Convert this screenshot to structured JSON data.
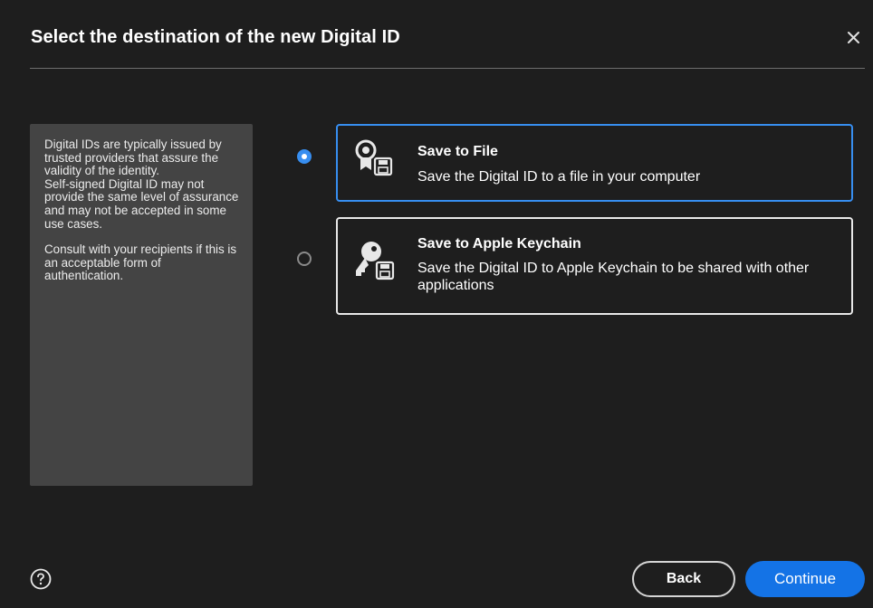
{
  "dialog": {
    "title": "Select the destination of the new Digital ID",
    "close_icon": "close-icon"
  },
  "info": {
    "paragraph1": "Digital IDs are typically issued by trusted providers that assure the validity of the identity.",
    "paragraph2": "Self-signed Digital ID may not provide the same level of assurance and may not be accepted in some use cases.",
    "paragraph3": "Consult with your recipients if this is an acceptable form of authentication."
  },
  "options": [
    {
      "title": "Save to File",
      "description": "Save the Digital ID to a file in your computer",
      "icon": "certificate-file-icon",
      "selected": true
    },
    {
      "title": "Save to Apple Keychain",
      "description": "Save the Digital ID to Apple Keychain to be shared with other applications",
      "icon": "key-save-icon",
      "selected": false
    }
  ],
  "footer": {
    "help_icon": "help-icon",
    "back_label": "Back",
    "continue_label": "Continue"
  },
  "colors": {
    "background": "#1e1e1e",
    "accent": "#1473e6",
    "selected_border": "#378ef0",
    "info_panel": "#444444"
  }
}
